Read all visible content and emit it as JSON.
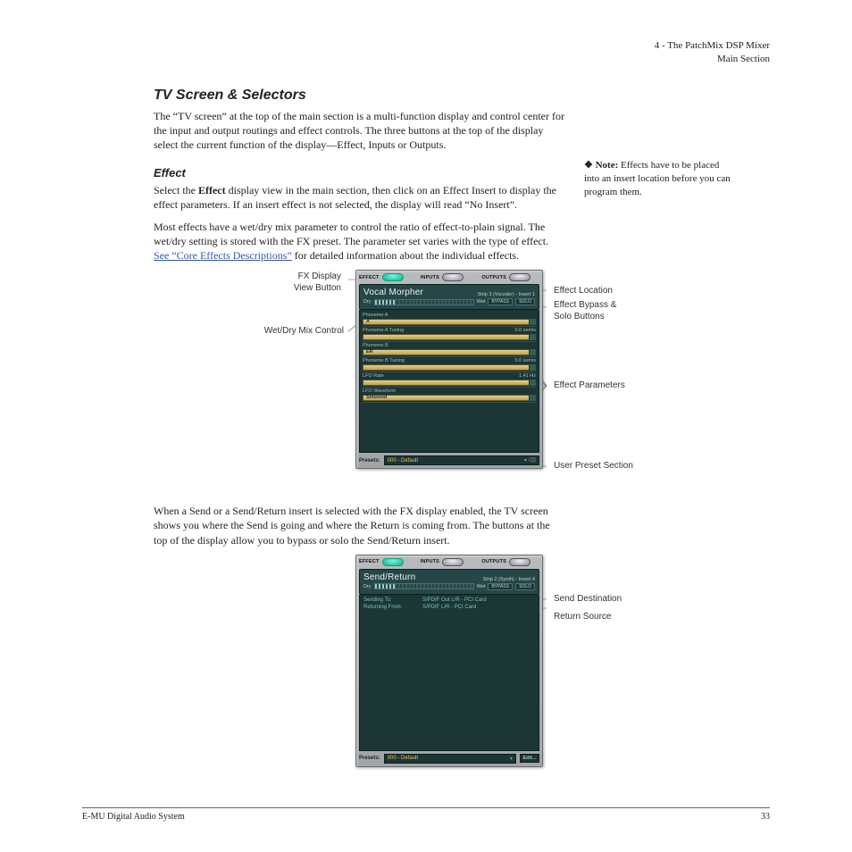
{
  "header": {
    "chapter": "4 - The PatchMix DSP Mixer",
    "section": "Main Section"
  },
  "h1": "TV Screen & Selectors",
  "p1": "The “TV screen” at the top of the main section is a multi-function display and control center for the input and output routings and effect controls. The three buttons at the top of the display select the current function of the display—Effect, Inputs or Outputs.",
  "h2": "Effect",
  "p2a": "Select the ",
  "p2b_bold": "Effect",
  "p2c": " display view in the main section, then click on an Effect Insert to display the effect parameters. If an insert effect is not selected, the display will read “No Insert”.",
  "p3a": "Most effects have a wet/dry mix parameter to control the ratio of effect-to-plain signal. The wet/dry setting is stored with the FX preset. The parameter set varies with the type of effect. ",
  "p3_link": "See “Core Effects Descriptions”",
  "p3b": " for detailed information about the individual effects.",
  "note_prefix": "❖  Note:",
  "note_body": " Effects have to be placed into an insert location before you can program them.",
  "callouts1": {
    "fx_button": "FX Display\nView Button",
    "wetdry": "Wet/Dry Mix Control",
    "effect_location": "Effect Location",
    "bypass_solo": "Effect Bypass &\nSolo Buttons",
    "params": "Effect Parameters",
    "preset": "User Preset Section"
  },
  "panel1": {
    "tabs": {
      "effect": "EFFECT",
      "inputs": "INPUTS",
      "outputs": "OUTPUTS"
    },
    "title": "Vocal Morpher",
    "loc": "Strip 3 (Vocoder) - Insert 1",
    "dry": "Dry",
    "wet": "Wet",
    "bypass": "BYPASS",
    "solo": "SOLO",
    "params": [
      {
        "name": "Phoneme A",
        "value": "A"
      },
      {
        "name": "Phoneme A Tuning",
        "value": "0.0 semis"
      },
      {
        "name": "Phoneme B",
        "value": "ER"
      },
      {
        "name": "Phoneme B Tuning",
        "value": "0.0 semis"
      },
      {
        "name": "LFO Rate",
        "value": "1.41 Hz"
      },
      {
        "name": "LFO Waveform",
        "value": "Sinusoid"
      }
    ],
    "preset_label": "Presets:",
    "preset_value": "000 - Default"
  },
  "p4": "When a Send or a Send/Return insert is selected with the FX display enabled, the TV screen shows you where the Send is going and where the Return is coming from. The buttons at the top of the display allow you to bypass or solo the Send/Return insert.",
  "callouts2": {
    "send_dest": "Send Destination",
    "return_src": "Return Source"
  },
  "panel2": {
    "tabs": {
      "effect": "EFFECT",
      "inputs": "INPUTS",
      "outputs": "OUTPUTS"
    },
    "title": "Send/Return",
    "loc": "Strip 2 (Synth) - Insert 4",
    "dry": "Dry",
    "wet": "Wet",
    "bypass": "BYPASS",
    "solo": "SOLO",
    "send_label": "Sending To:",
    "send_val": "S/PDIF Out L/R - PCI Card",
    "ret_label": "Returning From:",
    "ret_val": "S/PDIF L/R - PCI Card",
    "preset_label": "Presets:",
    "preset_value": "000 - Default",
    "edit": "Edit..."
  },
  "footer": {
    "left": "E-MU Digital Audio System",
    "right": "33"
  }
}
